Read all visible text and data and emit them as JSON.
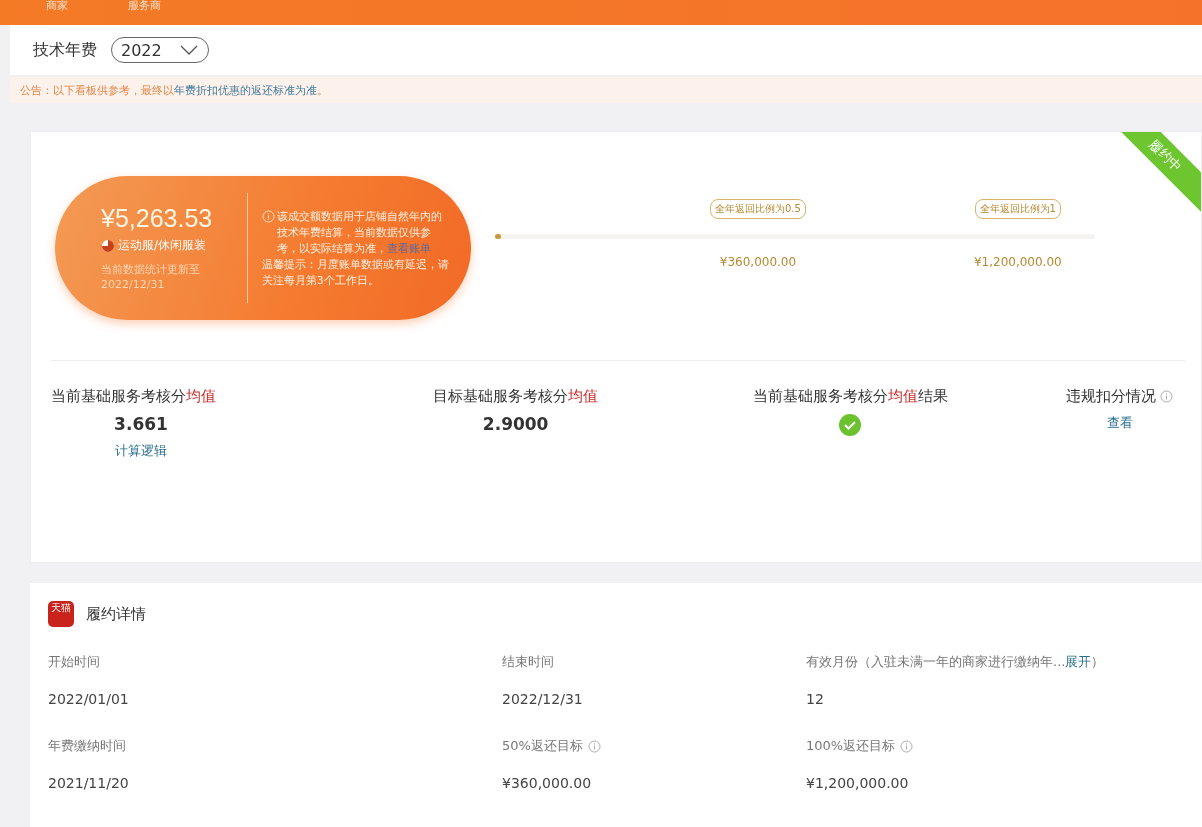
{
  "nav": [
    {
      "label": "商家",
      "selected": false
    },
    {
      "label": "服务商",
      "selected": false
    }
  ],
  "header": {
    "title": "技术年费",
    "year_select": {
      "value": "2022"
    }
  },
  "notice": {
    "prefix": "公告：以下看板供参考，最终以",
    "link": "年费折扣优惠的返还标准为准",
    "suffix": "。"
  },
  "summary": {
    "status_ribbon": "履约中",
    "amount": "¥5,263.53",
    "category": "运动服/休闲服装",
    "updated": "当前数据统计更新至2022/12/31",
    "info": "该成交额数据用于店铺自然年内的技术年费结算，当前数据仅供参考，以实际结算为准，",
    "info_link": "查看账单",
    "tip": "温馨提示：月度账单数据或有延迟，请关注每月第3个工作日。",
    "progress": {
      "level": 0.0,
      "milestones": [
        {
          "tooltip": "全年返回比例为0.5",
          "amount": "¥360,000.00"
        },
        {
          "tooltip": "全年返回比例为1",
          "amount": "¥1,200,000.00"
        }
      ]
    }
  },
  "stats": [
    {
      "label": "当前基础服务考核分",
      "highlight": "均值",
      "info": false,
      "kind": "value",
      "value": "3.661",
      "link": "计算逻辑"
    },
    {
      "label": "目标基础服务考核分",
      "highlight": "均值",
      "info": false,
      "kind": "value",
      "value": "2.9000"
    },
    {
      "label": "当前基础服务考核分",
      "highlight": "均值",
      "label_end": "结果",
      "info": false,
      "kind": "check",
      "passed": true
    },
    {
      "label": "违规扣分情况",
      "info": true,
      "kind": "link",
      "link": "查看"
    }
  ],
  "details": {
    "logo": "天猫",
    "title": "履约详情",
    "fields": [
      {
        "label": "开始时间",
        "info": false,
        "value": "2022/01/01"
      },
      {
        "label": "结束时间",
        "info": false,
        "value": "2022/12/31"
      },
      {
        "label": "有效月份（入驻未满一年的商家进行缴纳年...",
        "link": "展开",
        "label_end": "）",
        "info": false,
        "value": "12"
      },
      {
        "label": "年费缴纳时间",
        "info": false,
        "value": "2021/11/20"
      },
      {
        "label": "50%返还目标",
        "info": true,
        "value": "¥360,000.00"
      },
      {
        "label": "100%返还目标",
        "info": true,
        "value": "¥1,200,000.00"
      }
    ]
  }
}
